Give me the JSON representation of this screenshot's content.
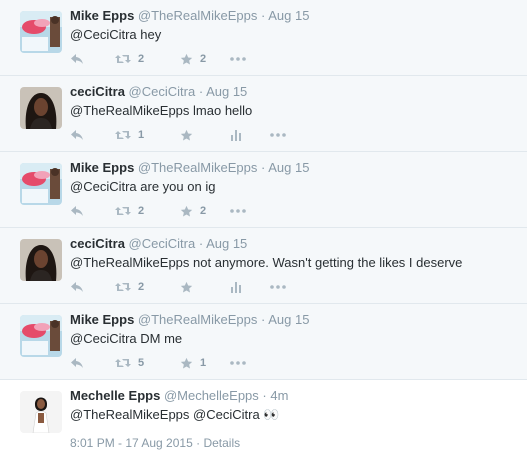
{
  "tweets": [
    {
      "name": "Mike Epps",
      "handle": "@TheRealMikeEpps",
      "sep": "·",
      "time": "Aug 15",
      "mention": "@CeciCitra",
      "text": " hey",
      "retweets": "2",
      "favorites": "2"
    },
    {
      "name": "ceciCitra",
      "handle": "@CeciCitra",
      "sep": "·",
      "time": "Aug 15",
      "mention": "@TheRealMikeEpps",
      "text": " lmao hello",
      "retweets": "1",
      "favorites": ""
    },
    {
      "name": "Mike Epps",
      "handle": "@TheRealMikeEpps",
      "sep": "·",
      "time": "Aug 15",
      "mention": "@CeciCitra",
      "text": " are you on ig",
      "retweets": "2",
      "favorites": "2"
    },
    {
      "name": "ceciCitra",
      "handle": "@CeciCitra",
      "sep": "·",
      "time": "Aug 15",
      "mention": "@TheRealMikeEpps",
      "text": " not anymore. Wasn't getting the likes I deserve",
      "retweets": "2",
      "favorites": ""
    },
    {
      "name": "Mike Epps",
      "handle": "@TheRealMikeEpps",
      "sep": "·",
      "time": "Aug 15",
      "mention": "@CeciCitra",
      "text": " DM me",
      "retweets": "5",
      "favorites": "1"
    }
  ],
  "focused": {
    "name": "Mechelle Epps",
    "handle": "@MechelleEpps",
    "sep": "·",
    "time": "4m",
    "mention1": "@TheRealMikeEpps",
    "mention2": "@CeciCitra",
    "emoji": "👀",
    "timestamp": "8:01 PM - 17 Aug 2015",
    "detail_sep": "·",
    "details_label": "Details"
  },
  "colors": {
    "link": "#292f33",
    "muted": "#8899a6",
    "icon": "#aab8c2",
    "row_bg": "#f5f8fa",
    "divider": "#e1e8ed"
  },
  "icons": [
    "reply-icon",
    "retweet-icon",
    "favorite-icon",
    "stats-icon",
    "more-icon"
  ]
}
